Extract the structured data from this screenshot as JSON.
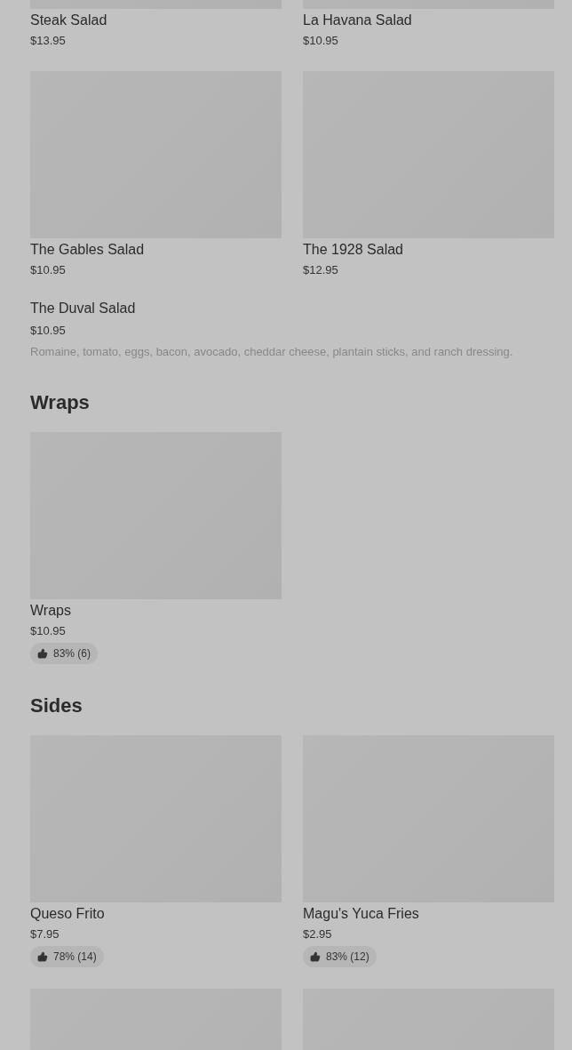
{
  "sections": [
    {
      "items": [
        {
          "kind": "with-image",
          "name": "Steak Salad",
          "price": "$13.95"
        },
        {
          "kind": "with-image",
          "name": "La Havana Salad",
          "price": "$10.95"
        },
        {
          "kind": "with-image",
          "name": "The Gables Salad",
          "price": "$10.95"
        },
        {
          "kind": "with-image",
          "name": "The 1928 Salad",
          "price": "$12.95"
        },
        {
          "kind": "text-only",
          "name": "The Duval Salad",
          "price": "$10.95",
          "description": "Romaine, tomato, eggs, bacon, avocado, cheddar cheese, plantain sticks, and ranch dressing."
        }
      ]
    },
    {
      "heading": "Wraps",
      "items": [
        {
          "kind": "with-image",
          "name": "Wraps",
          "price": "$10.95",
          "rating": "83% (6)"
        }
      ]
    },
    {
      "heading": "Sides",
      "items": [
        {
          "kind": "with-image",
          "name": "Queso Frito",
          "price": "$7.95",
          "rating": "78% (14)"
        },
        {
          "kind": "with-image",
          "name": "Magu's Yuca Fries",
          "price": "$2.95",
          "rating": "83% (12)"
        },
        {
          "kind": "image-only"
        },
        {
          "kind": "image-only"
        }
      ]
    }
  ]
}
